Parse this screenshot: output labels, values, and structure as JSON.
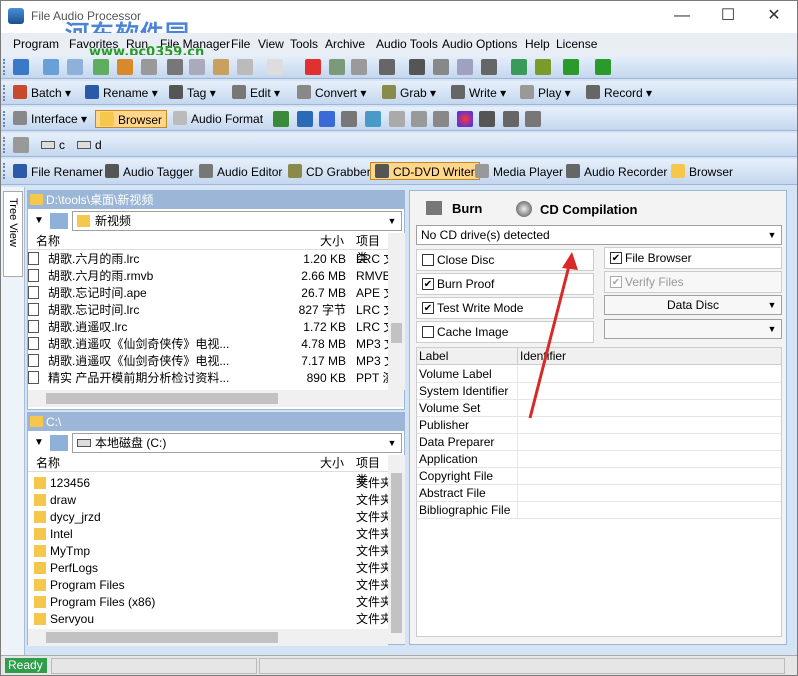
{
  "window": {
    "title": "File Audio Processor",
    "watermark": "河东软件园",
    "watermark_url": "www.pc0359.cn"
  },
  "menu": [
    "Program",
    "Favorites",
    "Run",
    "File Manager",
    "File",
    "View",
    "Tools",
    "Archive",
    "Audio Tools",
    "Audio Options",
    "Help",
    "License"
  ],
  "toolbar2": {
    "batch": "Batch",
    "rename": "Rename",
    "tag": "Tag",
    "edit": "Edit",
    "convert": "Convert",
    "grab": "Grab",
    "write": "Write",
    "play": "Play",
    "record": "Record"
  },
  "toolbar3": {
    "interface": "Interface",
    "browser": "Browser",
    "audio_format": "Audio Format"
  },
  "drives": {
    "c": "c",
    "d": "d"
  },
  "toolbar5": {
    "file_renamer": "File Renamer",
    "audio_tagger": "Audio Tagger",
    "audio_editor": "Audio Editor",
    "cd_grabber": "CD Grabber",
    "cd_dvd_writer": "CD-DVD Writer",
    "media_player": "Media Player",
    "audio_recorder": "Audio Recorder",
    "browser": "Browser"
  },
  "tree_view_label": "Tree View",
  "top_pane": {
    "path": "D:\\tools\\桌面\\新视频",
    "folder": "新视频",
    "col_name": "名称",
    "col_size": "大小",
    "col_type": "项目类",
    "files": [
      {
        "name": "胡歌.六月的雨.lrc",
        "size": "1.20 KB",
        "type": "LRC 文"
      },
      {
        "name": "胡歌.六月的雨.rmvb",
        "size": "2.66 MB",
        "type": "RMVB"
      },
      {
        "name": "胡歌.忘记时间.ape",
        "size": "26.7 MB",
        "type": "APE 文"
      },
      {
        "name": "胡歌.忘记时间.lrc",
        "size": "827 字节",
        "type": "LRC 文"
      },
      {
        "name": "胡歌.逍遥叹.lrc",
        "size": "1.72 KB",
        "type": "LRC 文"
      },
      {
        "name": "胡歌.逍遥叹《仙剑奇侠传》电视...",
        "size": "4.78 MB",
        "type": "MP3 文"
      },
      {
        "name": "胡歌.逍遥叹《仙剑奇侠传》电视...",
        "size": "7.17 MB",
        "type": "MP3 文"
      },
      {
        "name": "精实 产品开模前期分析检讨资料...",
        "size": "890 KB",
        "type": "PPT 演"
      }
    ]
  },
  "bottom_pane": {
    "path": "C:\\",
    "folder": "本地磁盘 (C:)",
    "col_name": "名称",
    "col_size": "大小",
    "col_type": "项目类",
    "files": [
      {
        "name": "123456",
        "type": "文件夹"
      },
      {
        "name": "draw",
        "type": "文件夹"
      },
      {
        "name": "dycy_jrzd",
        "type": "文件夹"
      },
      {
        "name": "Intel",
        "type": "文件夹"
      },
      {
        "name": "MyTmp",
        "type": "文件夹"
      },
      {
        "name": "PerfLogs",
        "type": "文件夹"
      },
      {
        "name": "Program Files",
        "type": "文件夹"
      },
      {
        "name": "Program Files (x86)",
        "type": "文件夹"
      },
      {
        "name": "Servyou",
        "type": "文件夹"
      }
    ]
  },
  "writer": {
    "burn": "Burn",
    "cd_compilation": "CD Compilation",
    "drive_status": "No CD drive(s) detected",
    "close_disc": "Close Disc",
    "burn_proof": "Burn Proof",
    "test_write_mode": "Test Write Mode",
    "cache_image": "Cache Image",
    "file_browser": "File Browser",
    "verify_files": "Verify Files",
    "disc_type": "Data Disc",
    "prop_col_label": "Label",
    "prop_col_identifier": "Identifier",
    "properties": [
      "Volume Label",
      "System Identifier",
      "Volume Set",
      "Publisher",
      "Data Preparer",
      "Application",
      "Copyright File",
      "Abstract File",
      "Bibliographic File"
    ]
  },
  "status": {
    "ready": "Ready"
  },
  "colors": {
    "accent": "#2e9e4a",
    "selected_tab": "#ffd68a",
    "toolbar": "#c4d7ee",
    "arrow": "#d92a2a"
  }
}
